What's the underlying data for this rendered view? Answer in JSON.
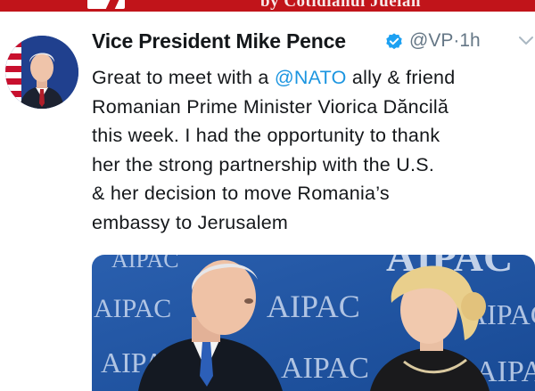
{
  "banner": {
    "text": "by Cotidianul Juelan"
  },
  "tweet": {
    "display_name": "Vice President Mike Pence",
    "verified": true,
    "handle": "@VP",
    "separator": "·",
    "time": "1h",
    "text_lines": [
      {
        "before": "Great to meet with a ",
        "mention": "@NATO",
        "after": " ally & friend"
      },
      {
        "text": "Romanian Prime Minister Viorica Dăncilă"
      },
      {
        "text": "this week. I had the opportunity to thank"
      },
      {
        "text": "her the strong partnership with the U.S."
      },
      {
        "text": "& her decision to move Romania’s"
      },
      {
        "text": "embassy to Jerusalem"
      }
    ]
  },
  "media": {
    "backdrop_words": [
      "AIPAC",
      "AIPAC",
      "AIPAC",
      "AIPAC",
      "AIPAC",
      "AIPAC",
      "AIPAC",
      "AIPAC"
    ]
  },
  "colors": {
    "banner": "#c1141a",
    "link": "#1b95e0",
    "text": "#14171a",
    "muted": "#657786",
    "verified": "#1da1f2",
    "backdrop_blue": "#1b4f9c"
  },
  "icons": [
    "verified-badge-icon",
    "chevron-down-icon"
  ]
}
